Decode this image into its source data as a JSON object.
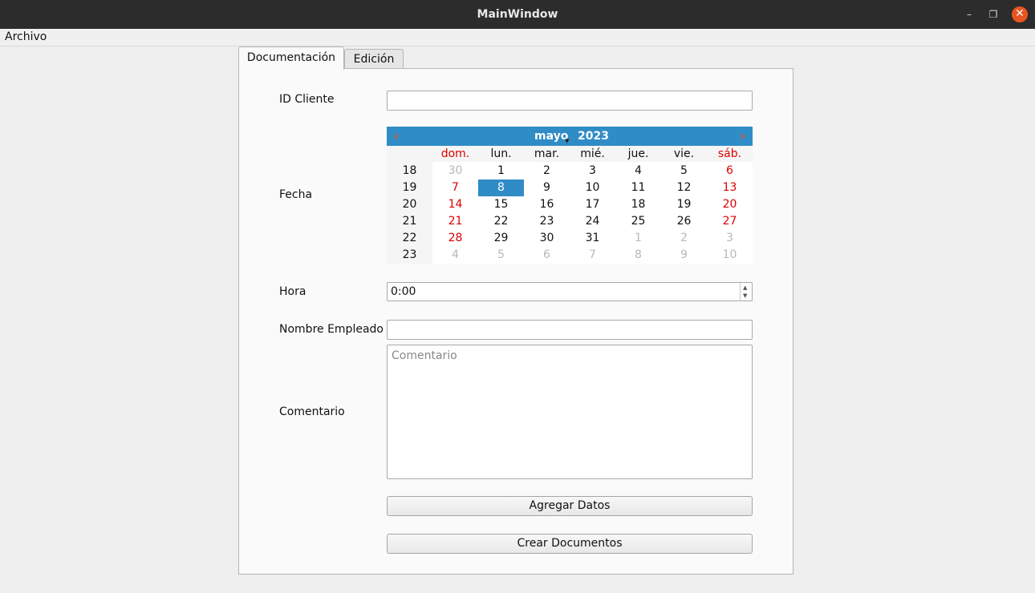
{
  "window": {
    "title": "MainWindow",
    "minimize": "–",
    "maximize": "❐",
    "close": "✕"
  },
  "menubar": {
    "archivo": "Archivo"
  },
  "tabs": [
    {
      "label": "Documentación",
      "active": true
    },
    {
      "label": "Edición",
      "active": false
    }
  ],
  "form": {
    "id_cliente_label": "ID Cliente",
    "id_cliente_value": "",
    "fecha_label": "Fecha",
    "hora_label": "Hora",
    "hora_value": "0:00",
    "nombre_label": "Nombre Empleado",
    "nombre_value": "",
    "comentario_label": "Comentario",
    "comentario_placeholder": "Comentario"
  },
  "calendar": {
    "month": "mayo",
    "year": "2023",
    "prev_icon": "chevron-left-icon",
    "next_icon": "chevron-right-icon",
    "weekdays": [
      "dom.",
      "lun.",
      "mar.",
      "mié.",
      "jue.",
      "vie.",
      "sáb."
    ],
    "weeks": [
      {
        "num": "18",
        "days": [
          "30",
          "1",
          "2",
          "3",
          "4",
          "5",
          "6"
        ]
      },
      {
        "num": "19",
        "days": [
          "7",
          "8",
          "9",
          "10",
          "11",
          "12",
          "13"
        ]
      },
      {
        "num": "20",
        "days": [
          "14",
          "15",
          "16",
          "17",
          "18",
          "19",
          "20"
        ]
      },
      {
        "num": "21",
        "days": [
          "21",
          "22",
          "23",
          "24",
          "25",
          "26",
          "27"
        ]
      },
      {
        "num": "22",
        "days": [
          "28",
          "29",
          "30",
          "31",
          "1",
          "2",
          "3"
        ]
      },
      {
        "num": "23",
        "days": [
          "4",
          "5",
          "6",
          "7",
          "8",
          "9",
          "10"
        ]
      }
    ],
    "selected_day": "8",
    "accent_color": "#308cc6",
    "weekend_color": "#dd0000"
  },
  "buttons": {
    "agregar": "Agregar Datos",
    "crear": "Crear Documentos"
  }
}
